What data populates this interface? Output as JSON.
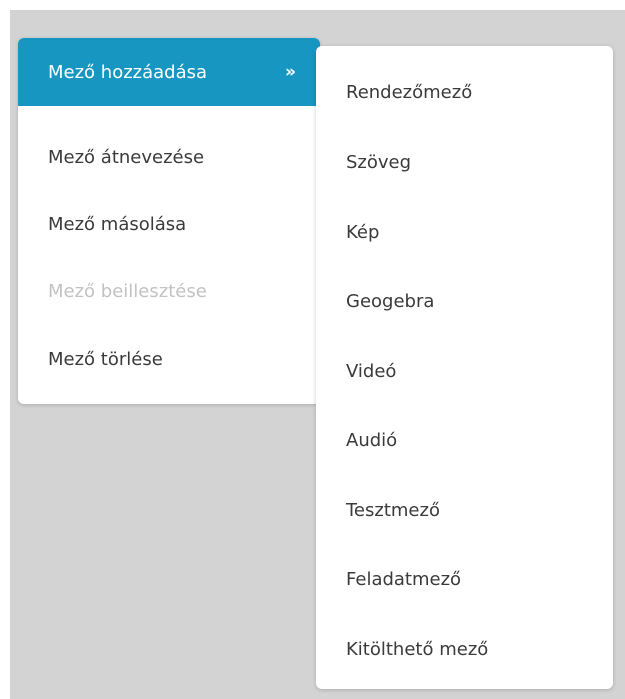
{
  "colors": {
    "backdrop": "#d3d3d3",
    "menu_bg": "#ffffff",
    "active_bg": "#1796c2",
    "text": "#3a3a3a",
    "disabled_text": "#c2c2c2"
  },
  "main_menu": {
    "items": [
      {
        "label": "Mező hozzáadása",
        "state": "active",
        "submenu_icon": "double-chevron-right-icon",
        "submenu_glyph": "»"
      },
      {
        "label": "Mező átnevezése",
        "state": "enabled"
      },
      {
        "label": "Mező másolása",
        "state": "enabled"
      },
      {
        "label": "Mező beillesztése",
        "state": "disabled"
      },
      {
        "label": "Mező törlése",
        "state": "enabled"
      }
    ]
  },
  "sub_menu": {
    "items": [
      {
        "label": "Rendezőmező"
      },
      {
        "label": "Szöveg"
      },
      {
        "label": "Kép"
      },
      {
        "label": "Geogebra"
      },
      {
        "label": "Videó"
      },
      {
        "label": "Audió"
      },
      {
        "label": "Tesztmező"
      },
      {
        "label": "Feladatmező"
      },
      {
        "label": "Kitölthető mező"
      }
    ]
  }
}
